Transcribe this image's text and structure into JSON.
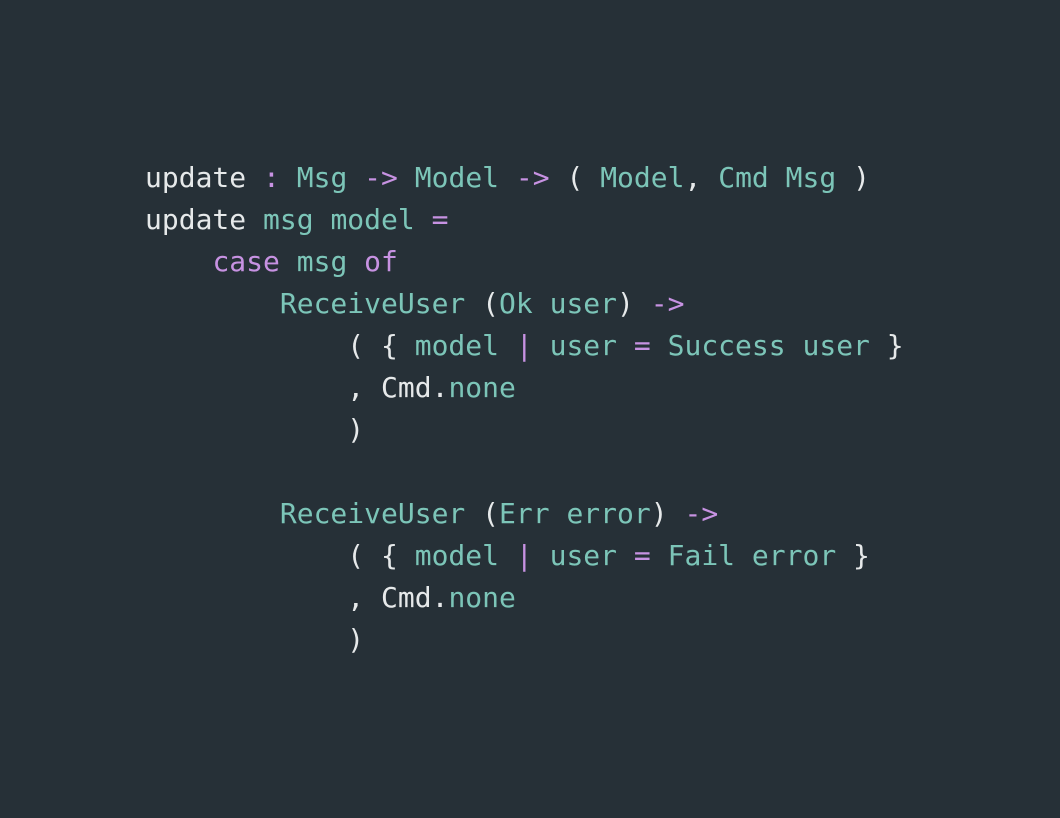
{
  "colors": {
    "background": "#263037",
    "plain": "#e6e9ea",
    "keyword": "#c792e2",
    "identifier": "#7cc5b8"
  },
  "code": {
    "language": "elm",
    "lines": [
      [
        {
          "text": "update",
          "kind": "plain"
        },
        {
          "text": " ",
          "kind": "plain"
        },
        {
          "text": ":",
          "kind": "keyword"
        },
        {
          "text": " ",
          "kind": "plain"
        },
        {
          "text": "Msg",
          "kind": "identifier"
        },
        {
          "text": " ",
          "kind": "plain"
        },
        {
          "text": "->",
          "kind": "keyword"
        },
        {
          "text": " ",
          "kind": "plain"
        },
        {
          "text": "Model",
          "kind": "identifier"
        },
        {
          "text": " ",
          "kind": "plain"
        },
        {
          "text": "->",
          "kind": "keyword"
        },
        {
          "text": " ( ",
          "kind": "plain"
        },
        {
          "text": "Model",
          "kind": "identifier"
        },
        {
          "text": ", ",
          "kind": "plain"
        },
        {
          "text": "Cmd",
          "kind": "identifier"
        },
        {
          "text": " ",
          "kind": "plain"
        },
        {
          "text": "Msg",
          "kind": "identifier"
        },
        {
          "text": " )",
          "kind": "plain"
        }
      ],
      [
        {
          "text": "update",
          "kind": "plain"
        },
        {
          "text": " ",
          "kind": "plain"
        },
        {
          "text": "msg",
          "kind": "identifier"
        },
        {
          "text": " ",
          "kind": "plain"
        },
        {
          "text": "model",
          "kind": "identifier"
        },
        {
          "text": " ",
          "kind": "plain"
        },
        {
          "text": "=",
          "kind": "keyword"
        }
      ],
      [
        {
          "text": "    ",
          "kind": "plain"
        },
        {
          "text": "case",
          "kind": "keyword"
        },
        {
          "text": " ",
          "kind": "plain"
        },
        {
          "text": "msg",
          "kind": "identifier"
        },
        {
          "text": " ",
          "kind": "plain"
        },
        {
          "text": "of",
          "kind": "keyword"
        }
      ],
      [
        {
          "text": "        ",
          "kind": "plain"
        },
        {
          "text": "ReceiveUser",
          "kind": "identifier"
        },
        {
          "text": " (",
          "kind": "plain"
        },
        {
          "text": "Ok",
          "kind": "identifier"
        },
        {
          "text": " ",
          "kind": "plain"
        },
        {
          "text": "user",
          "kind": "identifier"
        },
        {
          "text": ") ",
          "kind": "plain"
        },
        {
          "text": "->",
          "kind": "keyword"
        }
      ],
      [
        {
          "text": "            ( { ",
          "kind": "plain"
        },
        {
          "text": "model",
          "kind": "identifier"
        },
        {
          "text": " ",
          "kind": "plain"
        },
        {
          "text": "|",
          "kind": "keyword"
        },
        {
          "text": " ",
          "kind": "plain"
        },
        {
          "text": "user",
          "kind": "identifier"
        },
        {
          "text": " ",
          "kind": "plain"
        },
        {
          "text": "=",
          "kind": "keyword"
        },
        {
          "text": " ",
          "kind": "plain"
        },
        {
          "text": "Success",
          "kind": "identifier"
        },
        {
          "text": " ",
          "kind": "plain"
        },
        {
          "text": "user",
          "kind": "identifier"
        },
        {
          "text": " }",
          "kind": "plain"
        }
      ],
      [
        {
          "text": "            , Cmd.",
          "kind": "plain"
        },
        {
          "text": "none",
          "kind": "identifier"
        }
      ],
      [
        {
          "text": "            )",
          "kind": "plain"
        }
      ],
      [
        {
          "text": "",
          "kind": "plain"
        }
      ],
      [
        {
          "text": "        ",
          "kind": "plain"
        },
        {
          "text": "ReceiveUser",
          "kind": "identifier"
        },
        {
          "text": " (",
          "kind": "plain"
        },
        {
          "text": "Err",
          "kind": "identifier"
        },
        {
          "text": " ",
          "kind": "plain"
        },
        {
          "text": "error",
          "kind": "identifier"
        },
        {
          "text": ") ",
          "kind": "plain"
        },
        {
          "text": "->",
          "kind": "keyword"
        }
      ],
      [
        {
          "text": "            ( { ",
          "kind": "plain"
        },
        {
          "text": "model",
          "kind": "identifier"
        },
        {
          "text": " ",
          "kind": "plain"
        },
        {
          "text": "|",
          "kind": "keyword"
        },
        {
          "text": " ",
          "kind": "plain"
        },
        {
          "text": "user",
          "kind": "identifier"
        },
        {
          "text": " ",
          "kind": "plain"
        },
        {
          "text": "=",
          "kind": "keyword"
        },
        {
          "text": " ",
          "kind": "plain"
        },
        {
          "text": "Fail",
          "kind": "identifier"
        },
        {
          "text": " ",
          "kind": "plain"
        },
        {
          "text": "error",
          "kind": "identifier"
        },
        {
          "text": " }",
          "kind": "plain"
        }
      ],
      [
        {
          "text": "            , Cmd.",
          "kind": "plain"
        },
        {
          "text": "none",
          "kind": "identifier"
        }
      ],
      [
        {
          "text": "            )",
          "kind": "plain"
        }
      ]
    ]
  }
}
